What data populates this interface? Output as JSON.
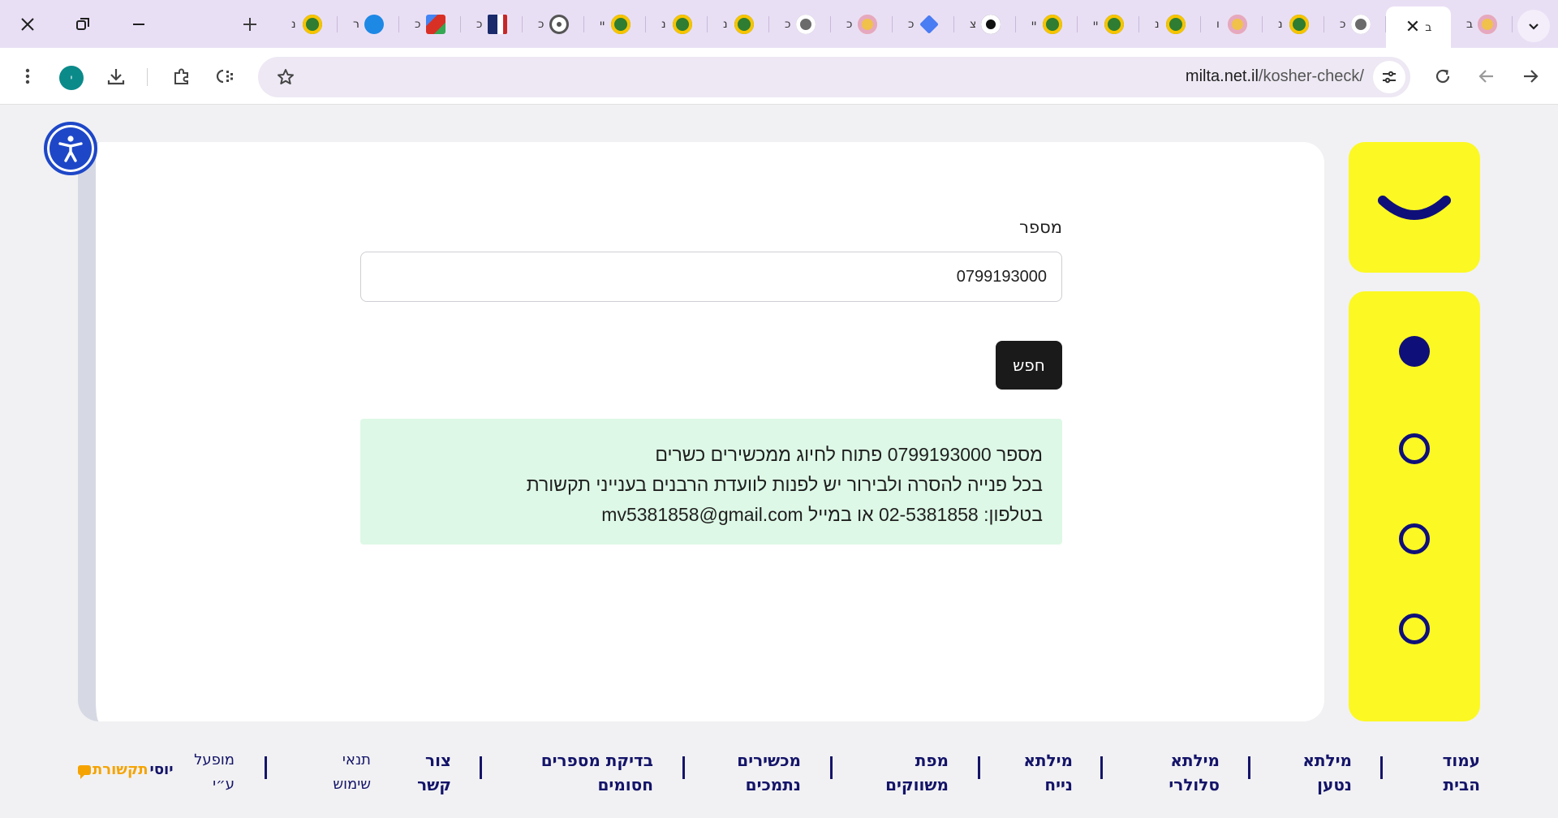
{
  "browser": {
    "tabs": [
      {
        "icon": "globe-favicon",
        "title": "ב",
        "color": "#f0c14b"
      },
      {
        "icon": "close-icon",
        "title": "ב",
        "active": true
      },
      {
        "icon": "globe-icon",
        "title": "כ",
        "color": "#6b6b6b"
      },
      {
        "icon": "tax-favicon",
        "title": "נ",
        "color": "#2e7d32"
      },
      {
        "icon": "globe-favicon",
        "title": "ו",
        "color": "#f0c14b"
      },
      {
        "icon": "tax-favicon",
        "title": "נ",
        "color": "#2e7d32"
      },
      {
        "icon": "tax-favicon",
        "title": "יי",
        "color": "#2e7d32"
      },
      {
        "icon": "tax-favicon",
        "title": "יי",
        "color": "#2e7d32"
      },
      {
        "icon": "openai-icon",
        "title": "צ",
        "color": "#111111"
      },
      {
        "icon": "gemini-icon",
        "title": "כ",
        "color": "#4a7cf3"
      },
      {
        "icon": "globe-favicon",
        "title": "כ",
        "color": "#f0c14b"
      },
      {
        "icon": "globe-icon",
        "title": "כ",
        "color": "#6b6b6b"
      },
      {
        "icon": "tax-favicon",
        "title": "נ",
        "color": "#2e7d32"
      },
      {
        "icon": "tax-favicon",
        "title": "נ",
        "color": "#2e7d32"
      },
      {
        "icon": "tax-favicon",
        "title": "יי",
        "color": "#2e7d32"
      },
      {
        "icon": "chrome-icon",
        "title": "כ",
        "color": "#555555"
      },
      {
        "icon": "portrait-favicon",
        "title": "כ",
        "color": "#1b2a6b"
      },
      {
        "icon": "gmail-icon",
        "title": "כ",
        "color": "#d93025"
      },
      {
        "icon": "edge-icon",
        "title": "ר",
        "color": "#1e88e5"
      },
      {
        "icon": "tax-favicon",
        "title": "נ",
        "color": "#2e7d32"
      }
    ],
    "window_controls": {
      "close": "close-icon",
      "restore": "restore-icon",
      "minimize": "minimize-icon",
      "new_tab": "plus-icon",
      "tab_search": "chevron-down-icon"
    },
    "address": {
      "host": "milta.net.il",
      "path": "/kosher-check/"
    },
    "profile_initial": "י"
  },
  "form": {
    "label": "מספר",
    "number_value": "0799193000",
    "search_button": "חפש"
  },
  "result": {
    "lines": [
      "מספר 0799193000 פתוח לחיוג ממכשירים כשרים",
      "בכל פנייה להסרה ולבירור יש לפנות לוועדת הרבנים בענייני תקשורת",
      "בטלפון: 02-5381858 או במייל mv5381858@gmail.com"
    ]
  },
  "side_panel": {
    "accent": "#fcf823",
    "dot_color": "#0f0f7a"
  },
  "footer": {
    "links": [
      {
        "l1": "עמוד",
        "l2": "הבית"
      },
      {
        "l1": "מילתא",
        "l2": "נטען"
      },
      {
        "l1": "מילתא",
        "l2": "סלולרי"
      },
      {
        "l1": "מילתא",
        "l2": "נייח"
      },
      {
        "l1": "מפת",
        "l2": "משווקים"
      },
      {
        "l1": "מכשירים",
        "l2": "נתמכים"
      },
      {
        "l1": "בדיקת מספרים",
        "l2": "חסומים"
      },
      {
        "l1": "צור",
        "l2": "קשר"
      }
    ],
    "terms": {
      "l1": "תנאי",
      "l2": "שימוש"
    },
    "operated_by": {
      "l1": "מופעל",
      "l2": "ע״י"
    },
    "credit_part1": "יוסי",
    "credit_part2": "תקשורת"
  }
}
